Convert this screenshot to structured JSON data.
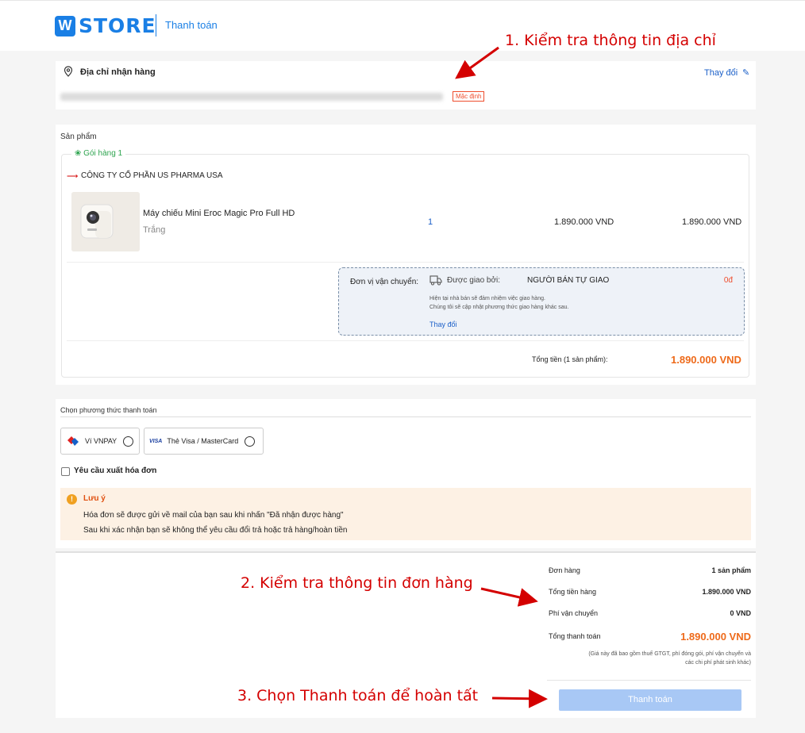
{
  "header": {
    "logo_mark": "W",
    "logo_text": "STORE",
    "page_name": "Thanh toán"
  },
  "annotations": {
    "step1": "1. Kiểm tra thông tin địa chỉ",
    "step2": "2. Kiểm tra thông tin đơn hàng",
    "step3": "3. Chọn Thanh toán để hoàn tất",
    "arrow_color": "#d40000"
  },
  "address": {
    "title": "Địa chỉ nhận hàng",
    "change_label": "Thay đổi",
    "default_badge": "Mặc định"
  },
  "products": {
    "section_label": "Sản phẩm",
    "package_label": "Gói hàng 1",
    "company": "CÔNG TY CỔ PHẦN US PHARMA USA",
    "item": {
      "name": "Máy chiếu Mini Eroc Magic Pro Full HD",
      "variant": "Trắng",
      "quantity": "1",
      "unit_price": "1.890.000 VND",
      "line_total": "1.890.000 VND"
    },
    "shipping": {
      "label": "Đơn vị vận chuyển:",
      "delivered_by_label": "Được giao bởi:",
      "carrier": "NGƯỜI BÁN TỰ GIAO",
      "fee": "0đ",
      "note_line1": "Hiện tại nhà bán sẽ đảm nhiệm việc giao hàng.",
      "note_line2": "Chúng tôi sẽ cập nhật phương thức giao hàng khác sau.",
      "change_label": "Thay đổi"
    },
    "subtotal_label": "Tổng tiền (1 sản phẩm):",
    "subtotal_value": "1.890.000 VND"
  },
  "payment": {
    "section_label": "Chọn phương thức thanh toán",
    "options": [
      {
        "label": "Ví VNPAY",
        "icon": "vnpay-icon"
      },
      {
        "label": "Thẻ Visa / MasterCard",
        "icon": "visa-icon",
        "icon_text": "VISA"
      }
    ],
    "invoice_label": "Yêu cầu xuất hóa đơn",
    "note": {
      "title": "Lưu ý",
      "line1": "Hóa đơn sẽ được gửi về mail của bạn sau khi nhấn \"Đã nhận được hàng\"",
      "line2": "Sau khi xác nhận bạn sẽ không thể yêu cầu đổi trả hoặc trả hàng/hoàn tiền"
    }
  },
  "summary": {
    "order_label": "Đơn hàng",
    "order_value": "1 sản phẩm",
    "goods_total_label": "Tổng tiền hàng",
    "goods_total_value": "1.890.000 VND",
    "shipping_fee_label": "Phí vận chuyển",
    "shipping_fee_value": "0 VND",
    "grand_total_label": "Tổng thanh toán",
    "grand_total_value": "1.890.000 VND",
    "vat_note_line1": "(Giá này đã bao gồm thuế GTGT, phí đóng gói, phí vận chuyển và",
    "vat_note_line2": "các chi phí phát sinh khác)",
    "pay_button": "Thanh toán"
  },
  "colors": {
    "brand": "#1a7fe5",
    "accent_orange": "#ee6a1a",
    "note_bg": "#fdf1e4",
    "pay_button_bg": "#a8c8f5"
  }
}
